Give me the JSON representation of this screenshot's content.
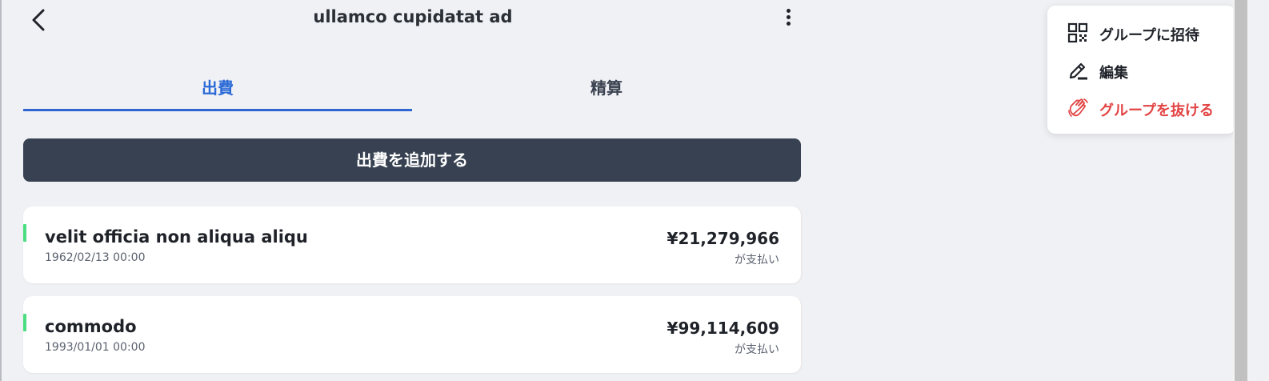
{
  "header": {
    "title": "ullamco cupidatat ad"
  },
  "tabs": [
    {
      "label": "出費",
      "active": true
    },
    {
      "label": "精算",
      "active": false
    }
  ],
  "add_button_label": "出費を追加する",
  "expenses": [
    {
      "title": "velit officia non aliqua aliqu",
      "date": "1962/02/13 00:00",
      "amount": "¥21,279,966",
      "paid_label": "が支払い"
    },
    {
      "title": "commodo",
      "date": "1993/01/01 00:00",
      "amount": "¥99,114,609",
      "paid_label": "が支払い"
    }
  ],
  "menu": {
    "items": [
      {
        "label": "グループに招待",
        "icon": "qr-code-icon"
      },
      {
        "label": "編集",
        "icon": "edit-pen-icon"
      },
      {
        "label": "グループを抜ける",
        "icon": "wave-hand-icon",
        "color": "#e24444"
      }
    ]
  },
  "colors": {
    "accent": "#2c6ad6",
    "primary_button": "#374151",
    "card_accent": "#4ade80",
    "danger": "#e24444",
    "background": "#eff1f5"
  }
}
